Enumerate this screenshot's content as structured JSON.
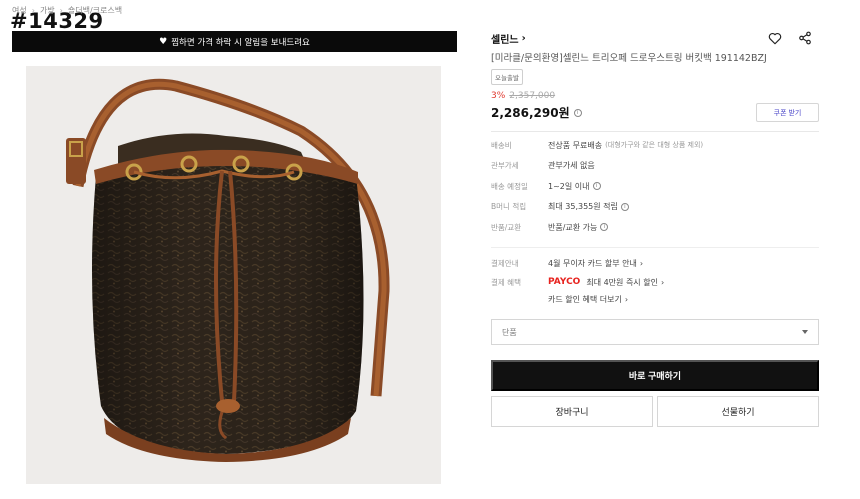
{
  "overlay_id": "#14329",
  "breadcrumb": [
    "여성",
    "가방",
    "숄더백/크로스백"
  ],
  "banner": {
    "icon": "heart-icon",
    "text": "찜하면 가격 하락 시 알림을 보내드려요"
  },
  "product": {
    "brand": "셀린느",
    "name": "[미라클/문의환영]셀린느 트리오페 드로우스트링 버킷백 191142BZJ",
    "tag": "오늘출발",
    "discount_rate": "3%",
    "original_price": "2,357,000",
    "price": "2,286,290원"
  },
  "coupon_label": "쿠폰 받기",
  "specs": [
    {
      "label": "배송비",
      "value": "전상품 무료배송",
      "note": "(대형가구와 같은 대형 상품 제외)",
      "info": false
    },
    {
      "label": "관부가세",
      "value": "관부가세 없음",
      "note": "",
      "info": false
    },
    {
      "label": "배송 예정일",
      "value": "1~2일 이내",
      "note": "",
      "info": true
    },
    {
      "label": "B머니 적립",
      "value": "최대 35,355원 적립",
      "note": "",
      "info": true
    },
    {
      "label": "반품/교환",
      "value": "반품/교환 가능",
      "note": "",
      "info": true
    }
  ],
  "payment": {
    "guide_label": "결제안내",
    "guide_value": "4월 무이자 카드 할부 안내",
    "benefit_label": "결제 혜택",
    "payco_brand": "PAYCO",
    "payco_value": "최대 4만원 즉시 할인",
    "card_link": "카드 할인 혜택 더보기"
  },
  "option_select": {
    "value": "단품"
  },
  "buttons": {
    "buy": "바로 구매하기",
    "cart": "장바구니",
    "gift": "선물하기"
  },
  "colors": {
    "accent_discount": "#e0392f",
    "payco": "#e7231f",
    "coupon_text": "#4a46c8",
    "primary_button": "#111111"
  }
}
